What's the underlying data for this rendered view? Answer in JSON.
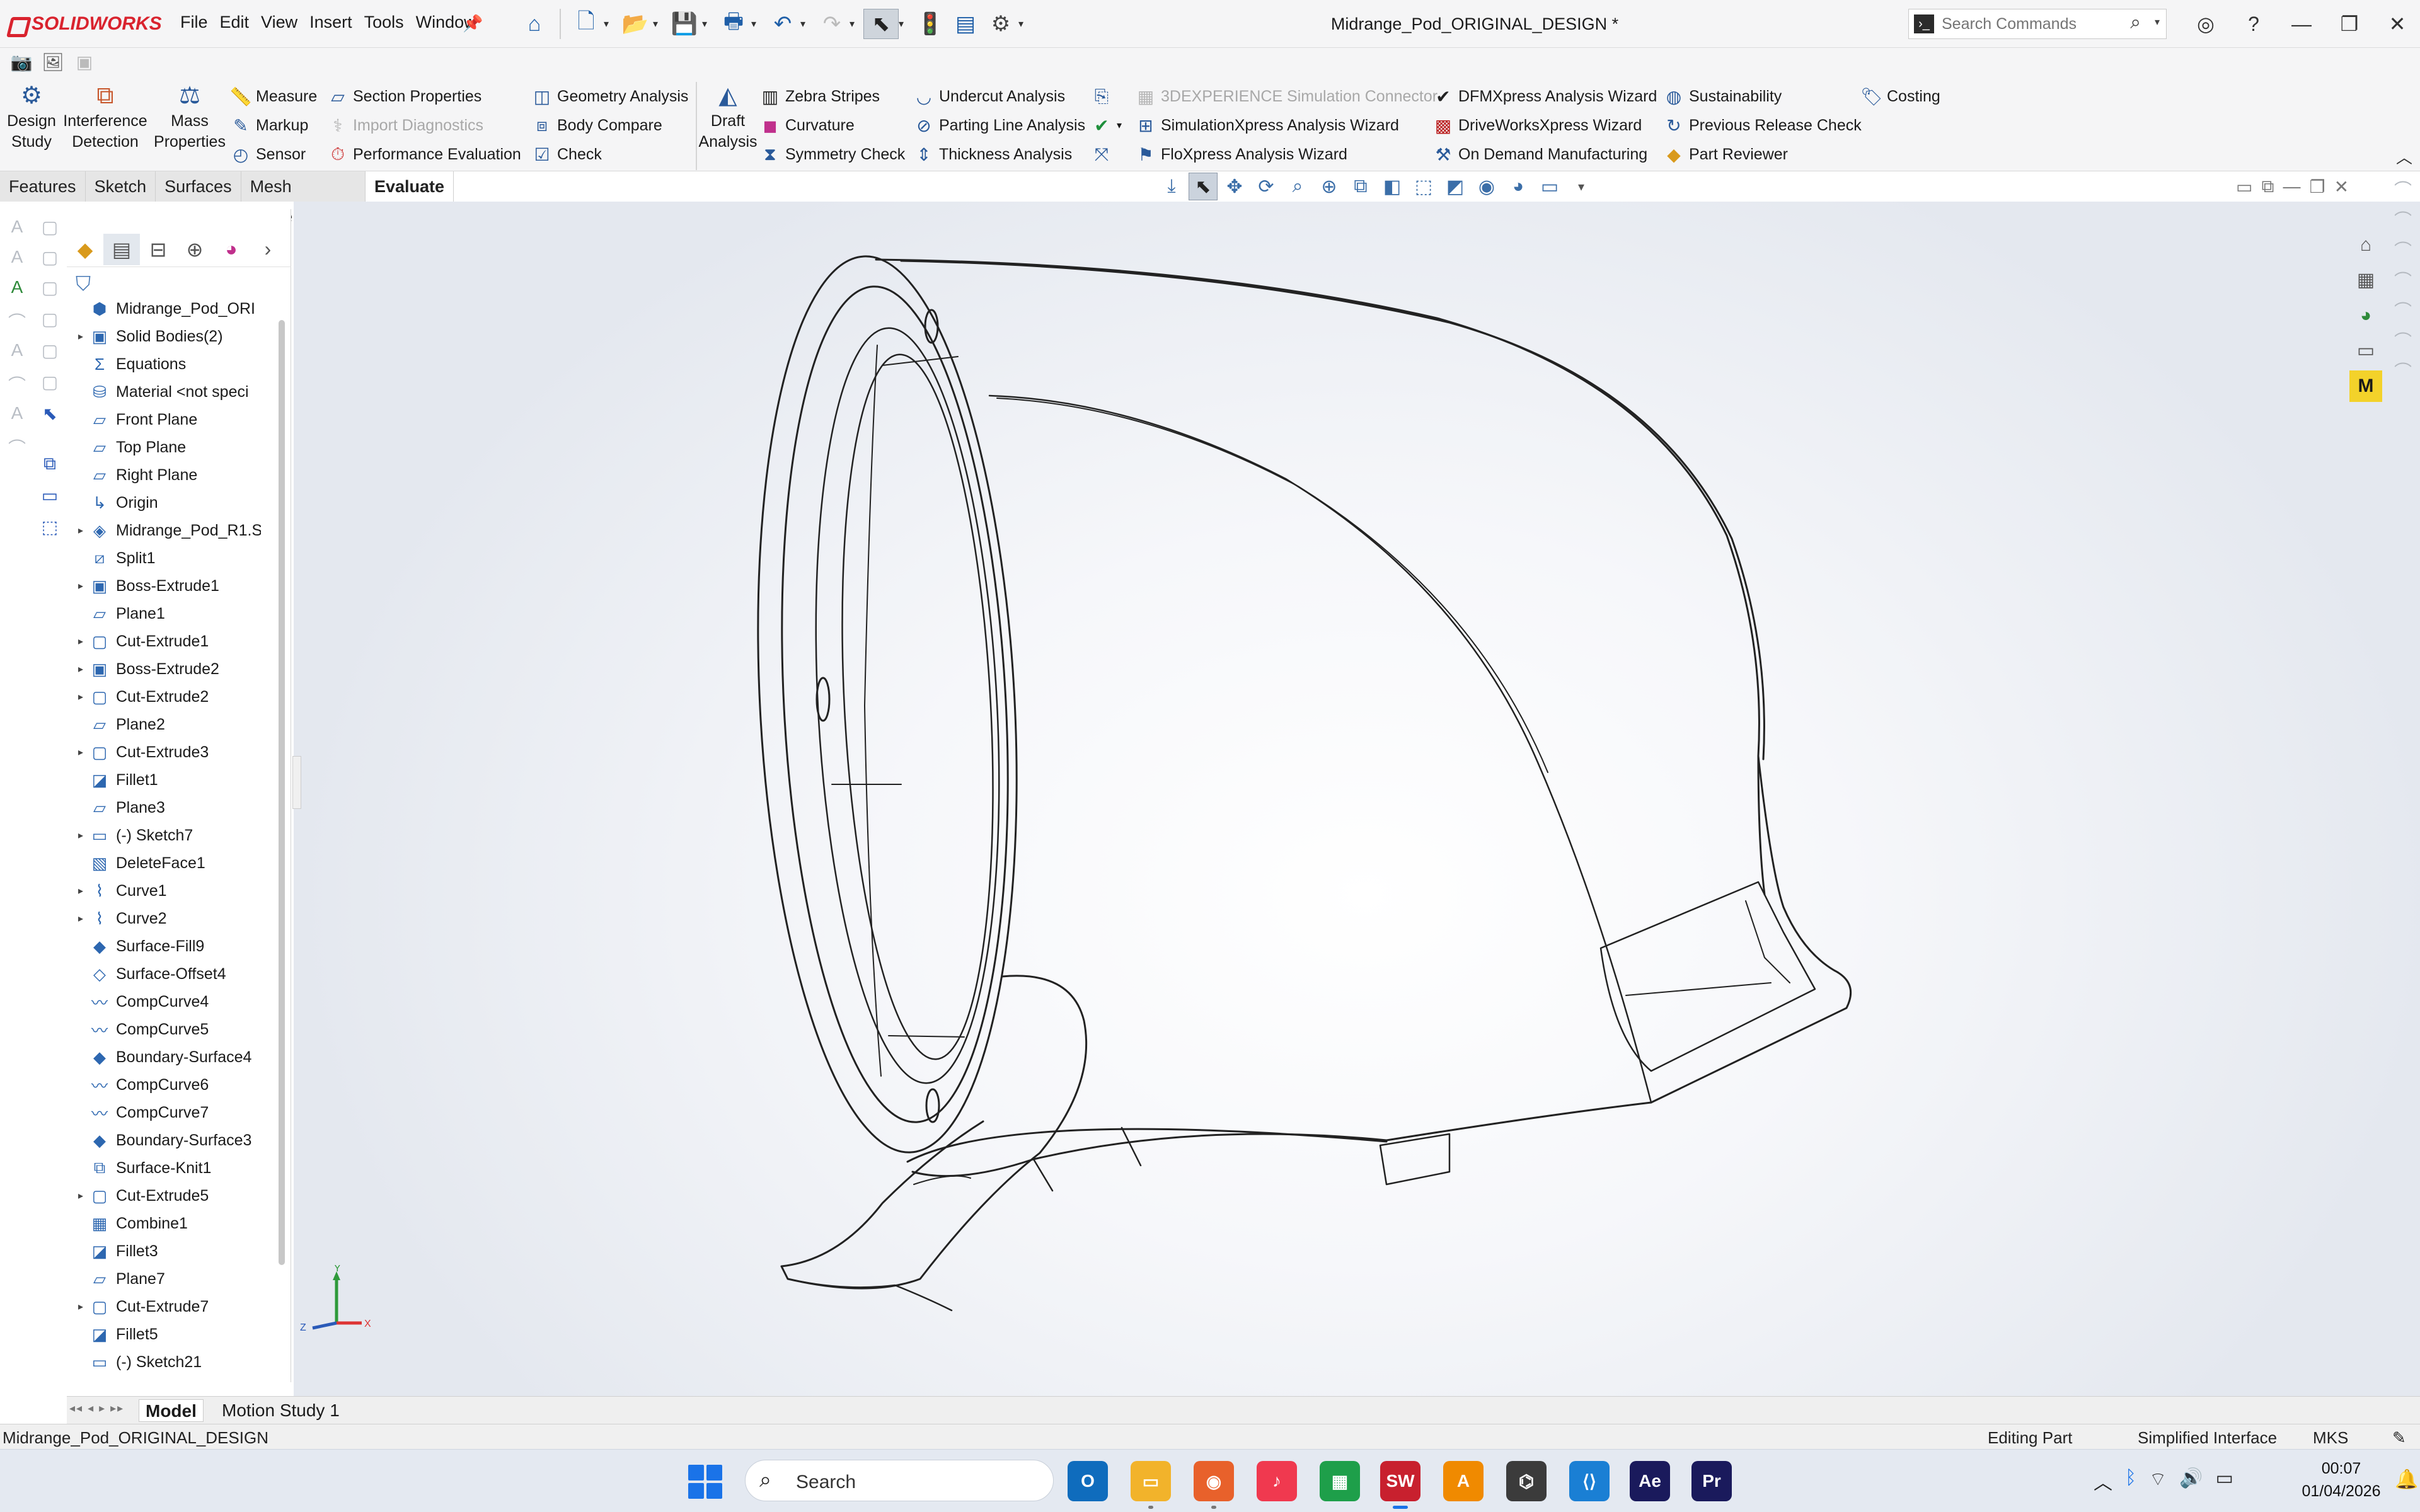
{
  "app": {
    "brand": "SOLIDWORKS",
    "document_title": "Midrange_Pod_ORIGINAL_DESIGN *"
  },
  "menu": [
    "File",
    "Edit",
    "View",
    "Insert",
    "Tools",
    "Window"
  ],
  "search_commands": {
    "placeholder": "Search Commands"
  },
  "ribbon": {
    "big_buttons": {
      "design_study": "Design Study",
      "interference": "Interference Detection",
      "mass": "Mass Properties",
      "draft": "Draft Analysis"
    },
    "col1": [
      "Measure",
      "Markup",
      "Sensor"
    ],
    "col2": [
      "Section Properties",
      "Import Diagnostics",
      "Performance Evaluation"
    ],
    "col3": [
      "Geometry Analysis",
      "Body Compare",
      "Check"
    ],
    "col4": [
      "Zebra Stripes",
      "Curvature",
      "Symmetry Check"
    ],
    "col5": [
      "Undercut Analysis",
      "Parting Line Analysis",
      "Thickness Analysis"
    ],
    "col6": [
      "3DEXPERIENCE Simulation Connector",
      "SimulationXpress Analysis Wizard",
      "FloXpress Analysis Wizard"
    ],
    "col7": [
      "DFMXpress Analysis Wizard",
      "DriveWorksXpress Wizard",
      "On Demand Manufacturing"
    ],
    "col8": [
      "Sustainability",
      "Previous Release Check",
      "Part Reviewer"
    ],
    "costing": "Costing"
  },
  "tabs": [
    "Features",
    "Sketch",
    "Surfaces",
    "Mesh Modeling",
    "Evaluate"
  ],
  "active_tab": "Evaluate",
  "feature_tree": [
    {
      "label": "Midrange_Pod_ORI",
      "icon": "part-icon",
      "expand": ""
    },
    {
      "label": "Solid Bodies(2)",
      "icon": "solid-bodies-folder-icon",
      "expand": "▸"
    },
    {
      "label": "Equations",
      "icon": "equations-icon",
      "expand": ""
    },
    {
      "label": "Material <not speci",
      "icon": "material-icon",
      "expand": ""
    },
    {
      "label": "Front Plane",
      "icon": "plane-icon",
      "expand": ""
    },
    {
      "label": "Top Plane",
      "icon": "plane-icon",
      "expand": ""
    },
    {
      "label": "Right Plane",
      "icon": "plane-icon",
      "expand": ""
    },
    {
      "label": "Origin",
      "icon": "origin-icon",
      "expand": ""
    },
    {
      "label": "Midrange_Pod_R1.S",
      "icon": "derived-part-icon",
      "expand": "▸"
    },
    {
      "label": "Split1",
      "icon": "split-icon",
      "expand": ""
    },
    {
      "label": "Boss-Extrude1",
      "icon": "boss-extrude-icon",
      "expand": "▸"
    },
    {
      "label": "Plane1",
      "icon": "plane-icon",
      "expand": ""
    },
    {
      "label": "Cut-Extrude1",
      "icon": "cut-extrude-icon",
      "expand": "▸"
    },
    {
      "label": "Boss-Extrude2",
      "icon": "boss-extrude-icon",
      "expand": "▸"
    },
    {
      "label": "Cut-Extrude2",
      "icon": "cut-extrude-icon",
      "expand": "▸"
    },
    {
      "label": "Plane2",
      "icon": "plane-icon",
      "expand": ""
    },
    {
      "label": "Cut-Extrude3",
      "icon": "cut-extrude-icon",
      "expand": "▸"
    },
    {
      "label": "Fillet1",
      "icon": "fillet-icon",
      "expand": ""
    },
    {
      "label": "Plane3",
      "icon": "plane-icon",
      "expand": ""
    },
    {
      "label": "(-) Sketch7",
      "icon": "sketch-icon",
      "expand": "▸"
    },
    {
      "label": "DeleteFace1",
      "icon": "delete-face-icon",
      "expand": ""
    },
    {
      "label": "Curve1",
      "icon": "curve-icon",
      "expand": "▸"
    },
    {
      "label": "Curve2",
      "icon": "curve-icon",
      "expand": "▸"
    },
    {
      "label": "Surface-Fill9",
      "icon": "surface-fill-icon",
      "expand": ""
    },
    {
      "label": "Surface-Offset4",
      "icon": "surface-offset-icon",
      "expand": ""
    },
    {
      "label": "CompCurve4",
      "icon": "composite-curve-icon",
      "expand": ""
    },
    {
      "label": "CompCurve5",
      "icon": "composite-curve-icon",
      "expand": ""
    },
    {
      "label": "Boundary-Surface4",
      "icon": "boundary-surface-icon",
      "expand": ""
    },
    {
      "label": "CompCurve6",
      "icon": "composite-curve-icon",
      "expand": ""
    },
    {
      "label": "CompCurve7",
      "icon": "composite-curve-icon",
      "expand": ""
    },
    {
      "label": "Boundary-Surface3",
      "icon": "boundary-surface-icon",
      "expand": ""
    },
    {
      "label": "Surface-Knit1",
      "icon": "surface-knit-icon",
      "expand": ""
    },
    {
      "label": "Cut-Extrude5",
      "icon": "cut-extrude-icon",
      "expand": "▸"
    },
    {
      "label": "Combine1",
      "icon": "combine-icon",
      "expand": ""
    },
    {
      "label": "Fillet3",
      "icon": "fillet-icon",
      "expand": ""
    },
    {
      "label": "Plane7",
      "icon": "plane-icon",
      "expand": ""
    },
    {
      "label": "Cut-Extrude7",
      "icon": "cut-extrude-icon",
      "expand": "▸"
    },
    {
      "label": "Fillet5",
      "icon": "fillet-icon",
      "expand": ""
    },
    {
      "label": "(-) Sketch21",
      "icon": "sketch-icon",
      "expand": ""
    }
  ],
  "triad": {
    "x": "X",
    "y": "Y",
    "z": "Z"
  },
  "model_tabs": [
    "Model",
    "Motion Study 1"
  ],
  "status": {
    "doc": "Midrange_Pod_ORIGINAL_DESIGN",
    "mode": "Editing Part",
    "interface": "Simplified Interface",
    "units": "MKS"
  },
  "taskbar": {
    "search": "Search",
    "apps": [
      {
        "name": "outlook-icon",
        "label": "",
        "color": "#0f6cbd"
      },
      {
        "name": "file-explorer-icon",
        "label": "",
        "color": "#f2b32b"
      },
      {
        "name": "firefox-icon",
        "label": "",
        "color": "#e8612b"
      },
      {
        "name": "music-icon",
        "label": "",
        "color": "#f0394f"
      },
      {
        "name": "sheets-icon",
        "label": "",
        "color": "#1e9f4a"
      },
      {
        "name": "solidworks-icon",
        "label": "SW",
        "color": "#c8202e"
      },
      {
        "name": "autodesk-icon",
        "label": "A",
        "color": "#f08a00"
      },
      {
        "name": "copilot-icon",
        "label": "",
        "color": "#3b3b3b"
      },
      {
        "name": "vscode-icon",
        "label": "",
        "color": "#1a7fd4"
      },
      {
        "name": "after-effects-icon",
        "label": "Ae",
        "color": "#1a1a5c"
      },
      {
        "name": "premiere-icon",
        "label": "Pr",
        "color": "#1a1a5c"
      }
    ],
    "time": "00:07",
    "date": "01/04/2026"
  }
}
